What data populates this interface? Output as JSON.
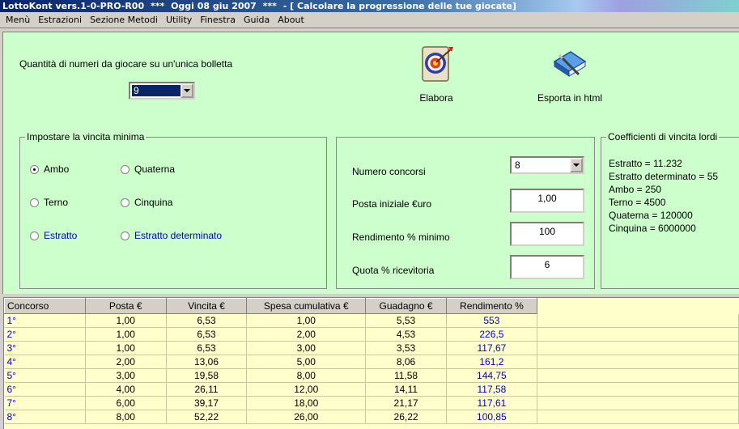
{
  "window": {
    "app_title": "LottoKont vers.1-0-PRO-R00",
    "stars": "***",
    "date_text": "Oggi 08 giu 2007",
    "doc_title": "- [ Calcolare la progressione delle tue giocate]"
  },
  "menu": [
    "Menù",
    "Estrazioni",
    "Sezione Metodi",
    "Utility",
    "Finestra",
    "Guida",
    "About"
  ],
  "quantity": {
    "label": "Quantità di numeri da giocare su un'unica bolletta",
    "value": "9"
  },
  "toolbar": {
    "elabora_label": "Elabora",
    "elabora_icon": "target-icon",
    "export_label": "Esporta in html",
    "export_icon": "book-pen-icon"
  },
  "vincita_group": {
    "legend": "Impostare la vincita minima",
    "options": [
      {
        "label": "Ambo",
        "selected": true
      },
      {
        "label": "Quaterna",
        "selected": false
      },
      {
        "label": "Terno",
        "selected": false
      },
      {
        "label": "Cinquina",
        "selected": false
      },
      {
        "label": "Estratto",
        "selected": false
      },
      {
        "label": "Estratto determinato",
        "selected": false
      }
    ]
  },
  "params": {
    "concorsi_label": "Numero concorsi",
    "concorsi_value": "8",
    "posta_label": "Posta iniziale €uro",
    "posta_value": "1,00",
    "rendimento_label": "Rendimento % minimo",
    "rendimento_value": "100",
    "quota_label": "Quota % ricevitoria",
    "quota_value": "6"
  },
  "coefficients": {
    "legend": "Coefficienti di vincita lordi",
    "lines": [
      "Estratto =  11.232",
      "Estratto determinato =  55",
      "Ambo =  250",
      "Terno =  4500",
      "Quaterna =  120000",
      "Cinquina =  6000000"
    ]
  },
  "table": {
    "headers": [
      "Concorso",
      "Posta €",
      "Vincita €",
      "Spesa cumulativa €",
      "Guadagno €",
      "Rendimento %"
    ],
    "rows": [
      [
        "1°",
        "1,00",
        "6,53",
        "1,00",
        "5,53",
        "553"
      ],
      [
        "2°",
        "1,00",
        "6,53",
        "2,00",
        "4,53",
        "226,5"
      ],
      [
        "3°",
        "1,00",
        "6,53",
        "3,00",
        "3,53",
        "117,67"
      ],
      [
        "4°",
        "2,00",
        "13,06",
        "5,00",
        "8,06",
        "161,2"
      ],
      [
        "5°",
        "3,00",
        "19,58",
        "8,00",
        "11,58",
        "144,75"
      ],
      [
        "6°",
        "4,00",
        "26,11",
        "12,00",
        "14,11",
        "117,58"
      ],
      [
        "7°",
        "6,00",
        "39,17",
        "18,00",
        "21,17",
        "117,61"
      ],
      [
        "8°",
        "8,00",
        "52,22",
        "26,00",
        "26,22",
        "100,85"
      ]
    ]
  },
  "colors": {
    "panel_bg": "#ccffcc",
    "grid_bg": "#ffffcc",
    "link_blue": "#0000cc",
    "titlebar_blue": "#0a246a"
  }
}
